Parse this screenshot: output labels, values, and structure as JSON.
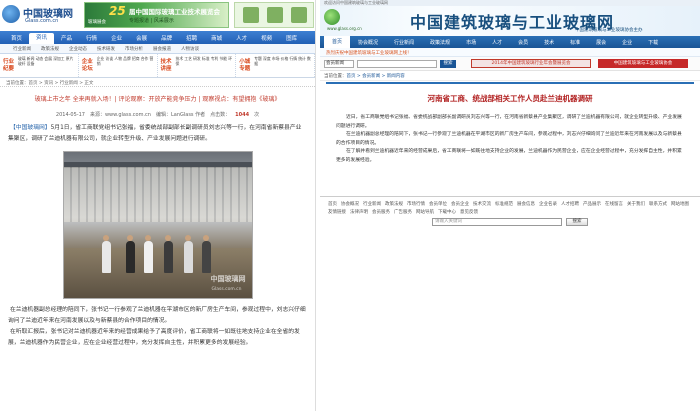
{
  "left": {
    "logo": {
      "name": "中国玻璃网",
      "url": "Glass.com.cn"
    },
    "banner": {
      "number": "25",
      "title": "届中国国际玻璃工业技术展览会",
      "subtitle": "专题报道 | 风采展示",
      "small": "玻璃展会"
    },
    "nav": [
      "首页",
      "资讯",
      "产品",
      "行情",
      "企业",
      "会展",
      "品牌",
      "招聘",
      "商城",
      "人才",
      "视频",
      "图库"
    ],
    "subnav": [
      "行业新闻",
      "政策法规",
      "企业动态",
      "技术研发",
      "市场分析",
      "展会报道",
      "人物访谈"
    ],
    "categories": [
      {
        "tag": "行业纪要",
        "links": "玻璃 新闻 动态 会展 深加工 原片 玻纤 设备"
      },
      {
        "tag": "企业论坛",
        "links": "企业 访谈 人物 品牌 招商 合作 营销"
      },
      {
        "tag": "技术讲座",
        "links": "技术 工艺 研发 标准 专利 节能 环保"
      },
      {
        "tag": "小城专题",
        "links": "专题 深度 市场 价格 行情 统计 数据"
      }
    ],
    "crumb": "当前位置：首页 > 资讯 > 行业新闻 > 正文",
    "headline": "玻璃上市之年  全来再就入场！| 评论观察：开放产能竞争压力 | 观察视点：有望拥抱《玻璃》",
    "meta": {
      "date": "2014-05-17",
      "source": "来源：www.glass.com.cn",
      "editor": "编辑：LanGlass 作者",
      "hits_label": "点击数：",
      "hits": "1044",
      "unit": "次"
    },
    "para1_source": "【中国玻璃网】",
    "para1": "5月1日，省工商联党组书记张福，省委统战部副部长副调研员刘志兴等一行，在河南省新蔡县产业集聚区，调研了兰迪机器有限公司，就企业转型升级、产业发展问题进行调研。",
    "para2": "在兰迪机器副总经理的陪同下，张书记一行参观了兰迪机器在平湖市区的新厂房生产车间，参观过程中，刘志兴仔细询问了兰迪近年来在河南发展以及与新蔡县的合作项目的情况。",
    "para3": "在听取汇报后，张书记对兰迪机器近年来的经营成果给予了高度评价，省工商联将一如既往地支持企业在全省的发展，兰迪机器作为民营企业，应在企业经营过程中，充分发挥自主性，并积累更多的发展经验。",
    "photo_watermark": "中国玻璃网",
    "photo_watermark2": "Glass.com.cn"
  },
  "right": {
    "top_text": "欢迎访问中国建筑玻璃与工业玻璃网",
    "logo_text": "www.glass.org.cn",
    "site_title": "中国建筑玻璃与工业玻璃网",
    "site_subtitle": "中国建筑玻璃与工业玻璃协会主办",
    "nav": [
      "首页",
      "协会概况",
      "行业新闻",
      "政策法规",
      "市场",
      "人才",
      "会员",
      "技术",
      "标准",
      "展会",
      "企业",
      "下载"
    ],
    "notice": "热烈庆祝中国建筑玻璃与工业玻璃网上线！",
    "search": {
      "select": "会员新闻",
      "button": "搜索"
    },
    "banner1": "2014年中国建筑玻璃行业年会暨展览会",
    "banner2": "中国建筑玻璃与工业玻璃协会",
    "crumb_prefix": "当前位置：",
    "crumb_links": "首页 > 会员新闻 > 新闻内容",
    "article_title": "河南省工商、统战部相关工作人员赴兰迪机器调研",
    "para1": "近日，省工商联党组书记张福、省委统战部副部长副调研员刘志兴等一行，在河南省新蔡县产业集聚区，调研了兰迪机器有限公司，就企业转型升级、产业发展问题进行调研。",
    "para2": "在兰迪机器副总经理的陪同下，张书记一行参观了兰迪机器在平湖市区的新厂房生产车间，参观过程中，刘志兴仔细询问了兰迪近年来在河南发展以及与新蔡县的合作项目的情况。",
    "para3": "在了解并看到兰迪机器近年来的经营成果后，省工商联将一如既往地支持企业的发展，兰迪机器作为民营企业，应在企业经营过程中，充分发挥自主性，并积累更多的发展经验。",
    "footer_links": [
      "首页",
      "协会概况",
      "行业新闻",
      "政策法规",
      "市场行情",
      "会员单位",
      "会员企业",
      "技术交流",
      "标准规范",
      "展会信息",
      "企业名录",
      "人才招聘",
      "产品展示",
      "在线留言",
      "关于我们",
      "联系方式",
      "网站地图",
      "友情链接",
      "法律声明",
      "会员服务",
      "广告服务",
      "网站导航",
      "下载中心",
      "意见反馈"
    ],
    "bottom_search": {
      "placeholder": "请输入关键词",
      "button": "搜索"
    }
  }
}
